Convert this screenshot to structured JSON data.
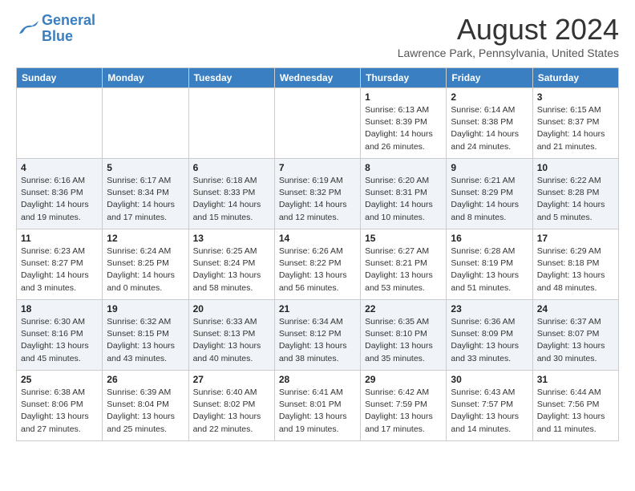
{
  "header": {
    "logo_line1": "General",
    "logo_line2": "Blue",
    "month": "August 2024",
    "location": "Lawrence Park, Pennsylvania, United States"
  },
  "weekdays": [
    "Sunday",
    "Monday",
    "Tuesday",
    "Wednesday",
    "Thursday",
    "Friday",
    "Saturday"
  ],
  "weeks": [
    [
      {
        "day": "",
        "info": ""
      },
      {
        "day": "",
        "info": ""
      },
      {
        "day": "",
        "info": ""
      },
      {
        "day": "",
        "info": ""
      },
      {
        "day": "1",
        "info": "Sunrise: 6:13 AM\nSunset: 8:39 PM\nDaylight: 14 hours\nand 26 minutes."
      },
      {
        "day": "2",
        "info": "Sunrise: 6:14 AM\nSunset: 8:38 PM\nDaylight: 14 hours\nand 24 minutes."
      },
      {
        "day": "3",
        "info": "Sunrise: 6:15 AM\nSunset: 8:37 PM\nDaylight: 14 hours\nand 21 minutes."
      }
    ],
    [
      {
        "day": "4",
        "info": "Sunrise: 6:16 AM\nSunset: 8:36 PM\nDaylight: 14 hours\nand 19 minutes."
      },
      {
        "day": "5",
        "info": "Sunrise: 6:17 AM\nSunset: 8:34 PM\nDaylight: 14 hours\nand 17 minutes."
      },
      {
        "day": "6",
        "info": "Sunrise: 6:18 AM\nSunset: 8:33 PM\nDaylight: 14 hours\nand 15 minutes."
      },
      {
        "day": "7",
        "info": "Sunrise: 6:19 AM\nSunset: 8:32 PM\nDaylight: 14 hours\nand 12 minutes."
      },
      {
        "day": "8",
        "info": "Sunrise: 6:20 AM\nSunset: 8:31 PM\nDaylight: 14 hours\nand 10 minutes."
      },
      {
        "day": "9",
        "info": "Sunrise: 6:21 AM\nSunset: 8:29 PM\nDaylight: 14 hours\nand 8 minutes."
      },
      {
        "day": "10",
        "info": "Sunrise: 6:22 AM\nSunset: 8:28 PM\nDaylight: 14 hours\nand 5 minutes."
      }
    ],
    [
      {
        "day": "11",
        "info": "Sunrise: 6:23 AM\nSunset: 8:27 PM\nDaylight: 14 hours\nand 3 minutes."
      },
      {
        "day": "12",
        "info": "Sunrise: 6:24 AM\nSunset: 8:25 PM\nDaylight: 14 hours\nand 0 minutes."
      },
      {
        "day": "13",
        "info": "Sunrise: 6:25 AM\nSunset: 8:24 PM\nDaylight: 13 hours\nand 58 minutes."
      },
      {
        "day": "14",
        "info": "Sunrise: 6:26 AM\nSunset: 8:22 PM\nDaylight: 13 hours\nand 56 minutes."
      },
      {
        "day": "15",
        "info": "Sunrise: 6:27 AM\nSunset: 8:21 PM\nDaylight: 13 hours\nand 53 minutes."
      },
      {
        "day": "16",
        "info": "Sunrise: 6:28 AM\nSunset: 8:19 PM\nDaylight: 13 hours\nand 51 minutes."
      },
      {
        "day": "17",
        "info": "Sunrise: 6:29 AM\nSunset: 8:18 PM\nDaylight: 13 hours\nand 48 minutes."
      }
    ],
    [
      {
        "day": "18",
        "info": "Sunrise: 6:30 AM\nSunset: 8:16 PM\nDaylight: 13 hours\nand 45 minutes."
      },
      {
        "day": "19",
        "info": "Sunrise: 6:32 AM\nSunset: 8:15 PM\nDaylight: 13 hours\nand 43 minutes."
      },
      {
        "day": "20",
        "info": "Sunrise: 6:33 AM\nSunset: 8:13 PM\nDaylight: 13 hours\nand 40 minutes."
      },
      {
        "day": "21",
        "info": "Sunrise: 6:34 AM\nSunset: 8:12 PM\nDaylight: 13 hours\nand 38 minutes."
      },
      {
        "day": "22",
        "info": "Sunrise: 6:35 AM\nSunset: 8:10 PM\nDaylight: 13 hours\nand 35 minutes."
      },
      {
        "day": "23",
        "info": "Sunrise: 6:36 AM\nSunset: 8:09 PM\nDaylight: 13 hours\nand 33 minutes."
      },
      {
        "day": "24",
        "info": "Sunrise: 6:37 AM\nSunset: 8:07 PM\nDaylight: 13 hours\nand 30 minutes."
      }
    ],
    [
      {
        "day": "25",
        "info": "Sunrise: 6:38 AM\nSunset: 8:06 PM\nDaylight: 13 hours\nand 27 minutes."
      },
      {
        "day": "26",
        "info": "Sunrise: 6:39 AM\nSunset: 8:04 PM\nDaylight: 13 hours\nand 25 minutes."
      },
      {
        "day": "27",
        "info": "Sunrise: 6:40 AM\nSunset: 8:02 PM\nDaylight: 13 hours\nand 22 minutes."
      },
      {
        "day": "28",
        "info": "Sunrise: 6:41 AM\nSunset: 8:01 PM\nDaylight: 13 hours\nand 19 minutes."
      },
      {
        "day": "29",
        "info": "Sunrise: 6:42 AM\nSunset: 7:59 PM\nDaylight: 13 hours\nand 17 minutes."
      },
      {
        "day": "30",
        "info": "Sunrise: 6:43 AM\nSunset: 7:57 PM\nDaylight: 13 hours\nand 14 minutes."
      },
      {
        "day": "31",
        "info": "Sunrise: 6:44 AM\nSunset: 7:56 PM\nDaylight: 13 hours\nand 11 minutes."
      }
    ]
  ]
}
